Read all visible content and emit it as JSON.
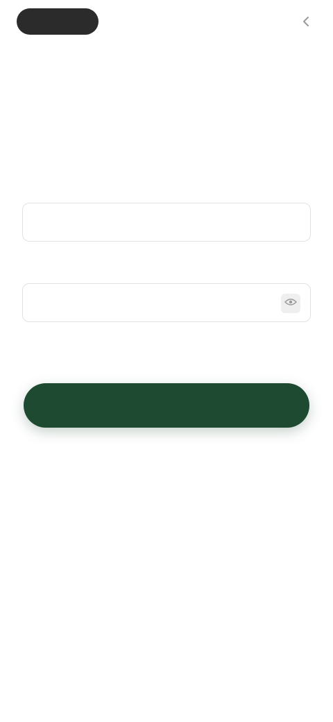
{
  "header": {
    "logo_text": "",
    "top_link": ""
  },
  "main": {
    "title": "",
    "email": {
      "label": "",
      "placeholder": "",
      "value": ""
    },
    "password": {
      "label": "",
      "placeholder": "",
      "value": ""
    },
    "forgot_link": "",
    "helper_note": "",
    "submit_label": ""
  },
  "colors": {
    "primary": "#1f4a32",
    "logo": "#2b2b2b",
    "text": "#222222"
  },
  "icons": {
    "top_link": "chevron-left-icon",
    "password_toggle": "eye-icon"
  }
}
